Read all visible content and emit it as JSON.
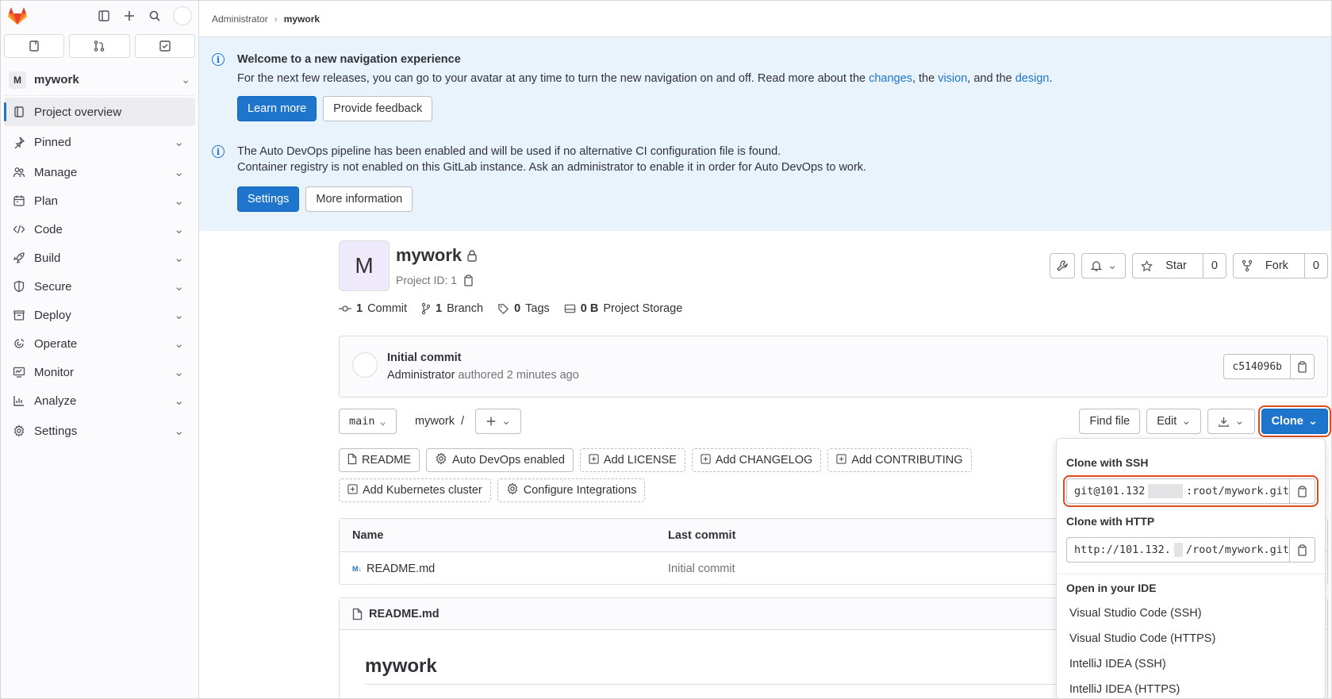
{
  "sidebar": {
    "project_initial": "M",
    "project_name": "mywork",
    "items": [
      {
        "label": "Project overview",
        "icon": "overview-icon"
      },
      {
        "label": "Pinned",
        "icon": "pin-icon"
      },
      {
        "label": "Manage",
        "icon": "users-icon"
      },
      {
        "label": "Plan",
        "icon": "calendar-icon"
      },
      {
        "label": "Code",
        "icon": "code-icon"
      },
      {
        "label": "Build",
        "icon": "rocket-icon"
      },
      {
        "label": "Secure",
        "icon": "shield-icon"
      },
      {
        "label": "Deploy",
        "icon": "deploy-icon"
      },
      {
        "label": "Operate",
        "icon": "cloud-icon"
      },
      {
        "label": "Monitor",
        "icon": "monitor-icon"
      },
      {
        "label": "Analyze",
        "icon": "chart-icon"
      },
      {
        "label": "Settings",
        "icon": "gear-icon"
      }
    ]
  },
  "breadcrumb": {
    "parent": "Administrator",
    "current": "mywork"
  },
  "alert_nav": {
    "title": "Welcome to a new navigation experience",
    "text_before": "For the next few releases, you can go to your avatar at any time to turn the new navigation on and off. Read more about the ",
    "link1": "changes",
    "mid1": ", the ",
    "link2": "vision",
    "mid2": ", and the ",
    "link3": "design",
    "end": ".",
    "primary_btn": "Learn more",
    "secondary_btn": "Provide feedback"
  },
  "alert_devops": {
    "line1": "The Auto DevOps pipeline has been enabled and will be used if no alternative CI configuration file is found.",
    "line2": "Container registry is not enabled on this GitLab instance. Ask an administrator to enable it in order for Auto DevOps to work.",
    "primary_btn": "Settings",
    "secondary_btn": "More information"
  },
  "project": {
    "initial": "M",
    "name": "mywork",
    "id_label": "Project ID: 1",
    "star_label": "Star",
    "star_count": "0",
    "fork_label": "Fork",
    "fork_count": "0"
  },
  "stats": {
    "commits_num": "1",
    "commits_label": "Commit",
    "branches_num": "1",
    "branches_label": "Branch",
    "tags_num": "0",
    "tags_label": "Tags",
    "storage_num": "0 B",
    "storage_label": "Project Storage"
  },
  "commit": {
    "title": "Initial commit",
    "author": "Administrator",
    "meta": " authored 2 minutes ago",
    "sha": "c514096b"
  },
  "toolbar": {
    "branch": "main",
    "path": "mywork",
    "path_sep": "/",
    "find_file": "Find file",
    "edit": "Edit",
    "clone": "Clone"
  },
  "chips": [
    {
      "label": "README",
      "dashed": false
    },
    {
      "label": "Auto DevOps enabled",
      "dashed": false
    },
    {
      "label": "Add LICENSE",
      "dashed": true
    },
    {
      "label": "Add CHANGELOG",
      "dashed": true
    },
    {
      "label": "Add CONTRIBUTING",
      "dashed": true
    },
    {
      "label": "Add Kubernetes cluster",
      "dashed": true
    },
    {
      "label": "Configure Integrations",
      "dashed": true
    }
  ],
  "files": {
    "col_name": "Name",
    "col_commit": "Last commit",
    "rows": [
      {
        "name": "README.md",
        "commit": "Initial commit"
      }
    ]
  },
  "readme": {
    "filename": "README.md",
    "heading": "mywork"
  },
  "clone_dropdown": {
    "ssh_title": "Clone with SSH",
    "ssh_prefix": "git@101.132",
    "ssh_suffix": ":root/mywork.git",
    "http_title": "Clone with HTTP",
    "http_prefix": "http://101.132.",
    "http_suffix": "/root/mywork.git",
    "ide_title": "Open in your IDE",
    "ide_items": [
      "Visual Studio Code (SSH)",
      "Visual Studio Code (HTTPS)",
      "IntelliJ IDEA (SSH)",
      "IntelliJ IDEA (HTTPS)"
    ]
  },
  "colors": {
    "accent": "#1f75cb",
    "highlight": "#e04b1c",
    "alert_bg": "#e9f3fc"
  }
}
